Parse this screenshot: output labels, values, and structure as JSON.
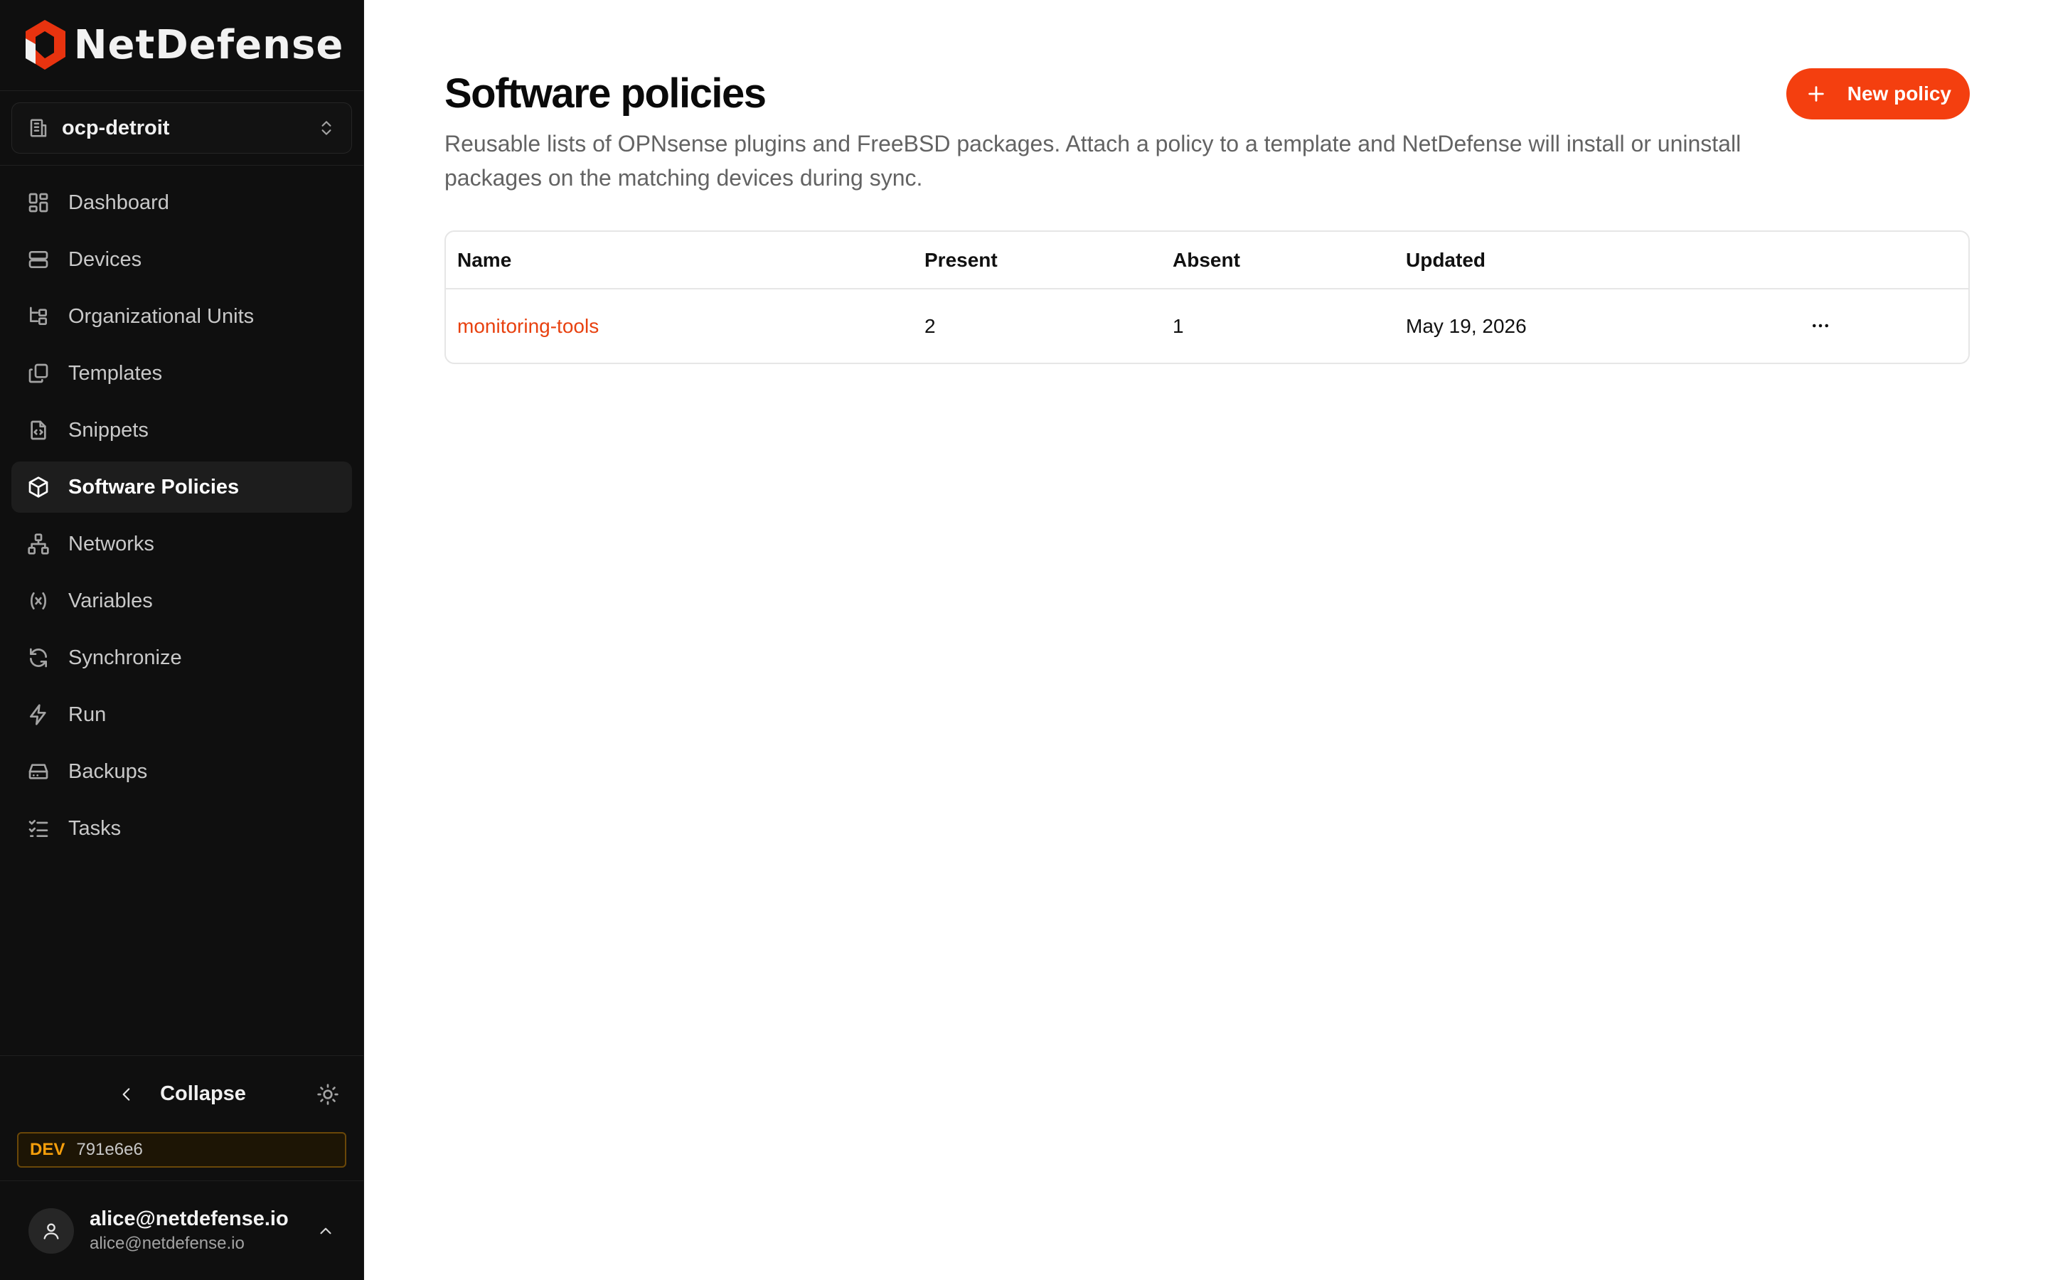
{
  "brand": {
    "name": "NetDefense"
  },
  "org_switcher": {
    "name": "ocp-detroit"
  },
  "sidebar": {
    "items": [
      {
        "label": "Dashboard",
        "icon": "dashboard-icon",
        "active": false
      },
      {
        "label": "Devices",
        "icon": "server-icon",
        "active": false
      },
      {
        "label": "Organizational Units",
        "icon": "hierarchy-icon",
        "active": false
      },
      {
        "label": "Templates",
        "icon": "copy-icon",
        "active": false
      },
      {
        "label": "Snippets",
        "icon": "file-code-icon",
        "active": false
      },
      {
        "label": "Software Policies",
        "icon": "package-icon",
        "active": true
      },
      {
        "label": "Networks",
        "icon": "network-icon",
        "active": false
      },
      {
        "label": "Variables",
        "icon": "variable-icon",
        "active": false
      },
      {
        "label": "Synchronize",
        "icon": "refresh-icon",
        "active": false
      },
      {
        "label": "Run",
        "icon": "zap-icon",
        "active": false
      },
      {
        "label": "Backups",
        "icon": "hard-drive-icon",
        "active": false
      },
      {
        "label": "Tasks",
        "icon": "list-checks-icon",
        "active": false
      }
    ],
    "collapse_label": "Collapse",
    "env": {
      "tag": "DEV",
      "hash": "791e6e6"
    },
    "user": {
      "name": "alice@netdefense.io",
      "email": "alice@netdefense.io"
    }
  },
  "page": {
    "title": "Software policies",
    "description": "Reusable lists of OPNsense plugins and FreeBSD packages. Attach a policy to a template and NetDefense will install or uninstall packages on the matching devices during sync.",
    "new_button_label": "New policy"
  },
  "table": {
    "columns": [
      "Name",
      "Present",
      "Absent",
      "Updated"
    ],
    "rows": [
      {
        "name": "monitoring-tools",
        "present": "2",
        "absent": "1",
        "updated": "May 19, 2026"
      }
    ]
  },
  "colors": {
    "accent": "#f43f0f",
    "sidebar_bg": "#0f0f0f",
    "dev_badge": "#f59e0b"
  }
}
